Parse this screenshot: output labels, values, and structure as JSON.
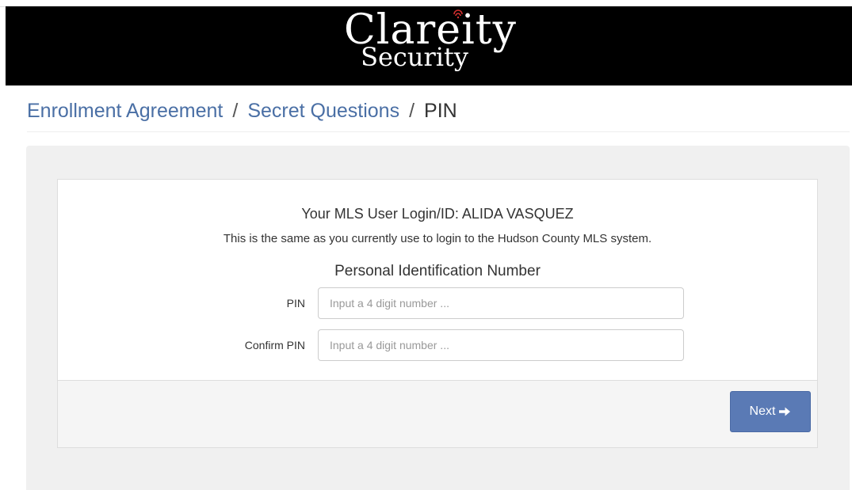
{
  "header": {
    "logo_main": "Clareity",
    "logo_sub": "Security",
    "background": "#000000"
  },
  "breadcrumb": {
    "items": [
      {
        "label": "Enrollment Agreement"
      },
      {
        "label": "Secret Questions"
      },
      {
        "label": "PIN"
      }
    ],
    "separator": "/",
    "link_color": "#4a6fa5"
  },
  "form": {
    "login_line": "Your MLS User Login/ID: ALIDA VASQUEZ",
    "info_line": "This is the same as you currently use to login to the Hudson County MLS system.",
    "section_title": "Personal Identification Number",
    "pin": {
      "label": "PIN",
      "value": "",
      "placeholder": "Input a 4 digit number ..."
    },
    "confirm_pin": {
      "label": "Confirm PIN",
      "value": "",
      "placeholder": "Input a 4 digit number ..."
    }
  },
  "footer": {
    "next_label": "Next",
    "next_icon": "arrow-right-icon",
    "button_color": "#5a7ab5"
  }
}
